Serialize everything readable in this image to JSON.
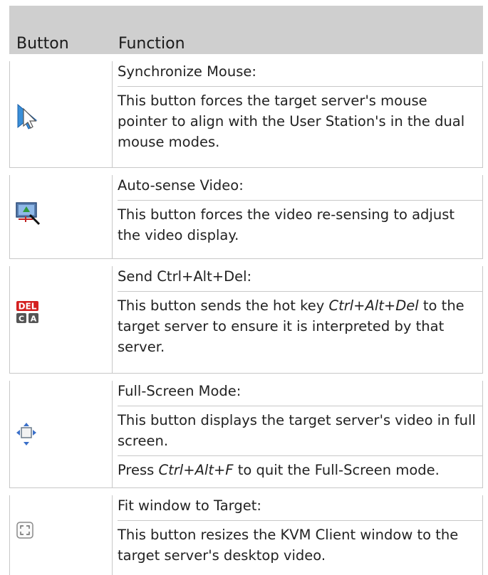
{
  "table": {
    "header": {
      "col1": "Button",
      "col2": "Function"
    },
    "rows": [
      {
        "icon": "synchronize-mouse-icon",
        "title": "Synchronize Mouse",
        "desc": "This button forces the target server's mouse pointer to align with the User Station's in the dual mouse modes."
      },
      {
        "icon": "auto-sense-video-icon",
        "title": "Auto-sense Video",
        "desc": "This button forces the video re-sensing to adjust the video display."
      },
      {
        "icon": "ctrl-alt-del-icon",
        "title": "Send Ctrl+Alt+Del",
        "desc_pre": "This button sends the hot key ",
        "desc_key": "Ctrl+Alt+Del",
        "desc_post": " to the target server to ensure it is interpreted by that server."
      },
      {
        "icon": "full-screen-icon",
        "title": "Full-Screen Mode",
        "desc": "This button displays the target server's video in full screen.",
        "note_pre": "Press ",
        "note_key": "Ctrl+Alt+F",
        "note_post": " to quit the Full-Screen mode."
      },
      {
        "icon": "fit-window-icon",
        "title": "Fit window to Target",
        "desc": "This button resizes the KVM Client window to the target server's desktop video."
      }
    ],
    "colon": ":",
    "icon_text": {
      "del": "DEL",
      "c": "C",
      "a": "A"
    }
  }
}
